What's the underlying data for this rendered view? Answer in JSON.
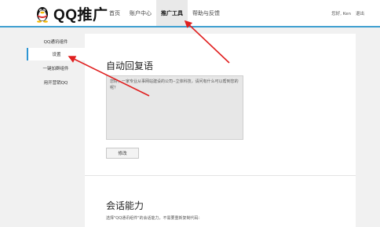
{
  "header": {
    "logo_text": "QQ推广",
    "nav": [
      {
        "label": "首页",
        "active": false
      },
      {
        "label": "账户中心",
        "active": false
      },
      {
        "label": "推广工具",
        "active": true
      },
      {
        "label": "帮助与反馈",
        "active": false
      }
    ],
    "user": {
      "greeting": "您好, Ken",
      "logout": "退出"
    }
  },
  "sidebar": {
    "items": [
      {
        "label": "QQ通讯组件",
        "active": false
      },
      {
        "label": "设置",
        "active": true
      },
      {
        "label": "一键加群组件",
        "active": false
      },
      {
        "label": "用开营销QQ",
        "active": false
      }
    ]
  },
  "main": {
    "auto_reply": {
      "title": "自动回复语",
      "value": "您好，一家专业从事网站建设的公司--立体科技，请问有什么可以帮到您的呢？",
      "modify_label": "修改"
    },
    "session": {
      "title": "会话能力",
      "description": "选择\"QQ通讯组件\"的会话能力，不需要重新复制代码："
    }
  },
  "colors": {
    "accent": "#3f9fd0",
    "annotation_arrow": "#e02020"
  }
}
